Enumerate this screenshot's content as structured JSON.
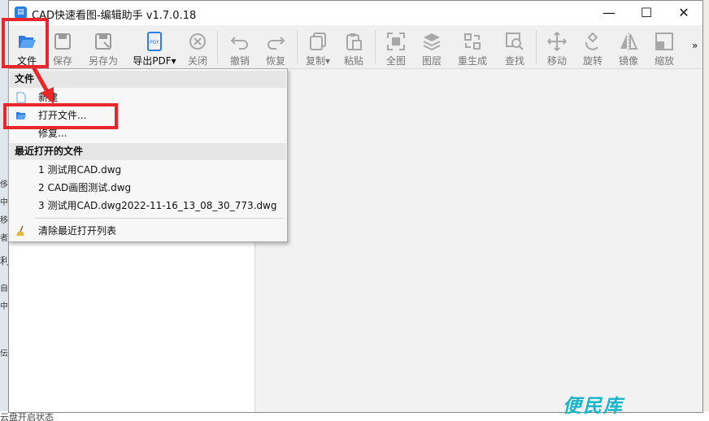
{
  "window": {
    "title": "CAD快速看图-编辑助手 v1.7.0.18",
    "controls": {
      "minimize": "—",
      "maximize": "☐",
      "close": "✕"
    }
  },
  "toolbar": {
    "items": [
      {
        "label": "文件",
        "icon": "open-folder-icon"
      },
      {
        "label": "保存",
        "icon": "save-icon"
      },
      {
        "label": "另存为",
        "icon": "save-as-icon"
      },
      {
        "label": "导出PDF▾",
        "icon": "pdf-icon"
      },
      {
        "label": "关闭",
        "icon": "close-circle-icon"
      },
      {
        "label": "撤销",
        "icon": "undo-icon"
      },
      {
        "label": "恢复",
        "icon": "redo-icon"
      },
      {
        "label": "复制▾",
        "icon": "copy-icon"
      },
      {
        "label": "粘贴",
        "icon": "paste-icon"
      },
      {
        "label": "全图",
        "icon": "fit-view-icon"
      },
      {
        "label": "图层",
        "icon": "layers-icon"
      },
      {
        "label": "重生成",
        "icon": "regenerate-icon"
      },
      {
        "label": "查找",
        "icon": "find-icon"
      },
      {
        "label": "移动",
        "icon": "move-icon"
      },
      {
        "label": "旋转",
        "icon": "rotate-icon"
      },
      {
        "label": "镜像",
        "icon": "mirror-icon"
      },
      {
        "label": "缩放",
        "icon": "scale-icon"
      }
    ],
    "more": "»"
  },
  "menu": {
    "file_header": "文件",
    "new": "新建",
    "open": "打开文件...",
    "repair": "修复...",
    "recent_header": "最近打开的文件",
    "recent": [
      "1 测试用CAD.dwg",
      "2 CAD画图测试.dwg",
      "3 测试用CAD.dwg2022-11-16_13_08_30_773.dwg"
    ],
    "clear_recent": "清除最近打开列表"
  },
  "background": {
    "left_fragments": [
      "侈",
      "中",
      "移",
      "者",
      "利",
      "自",
      "中",
      "伝"
    ],
    "bottom_text": "云盘开启状态"
  },
  "watermark": "便民库",
  "colors": {
    "accent": "#2a7fe0",
    "highlight": "#e8262b",
    "watermark": "#19b5c9"
  }
}
